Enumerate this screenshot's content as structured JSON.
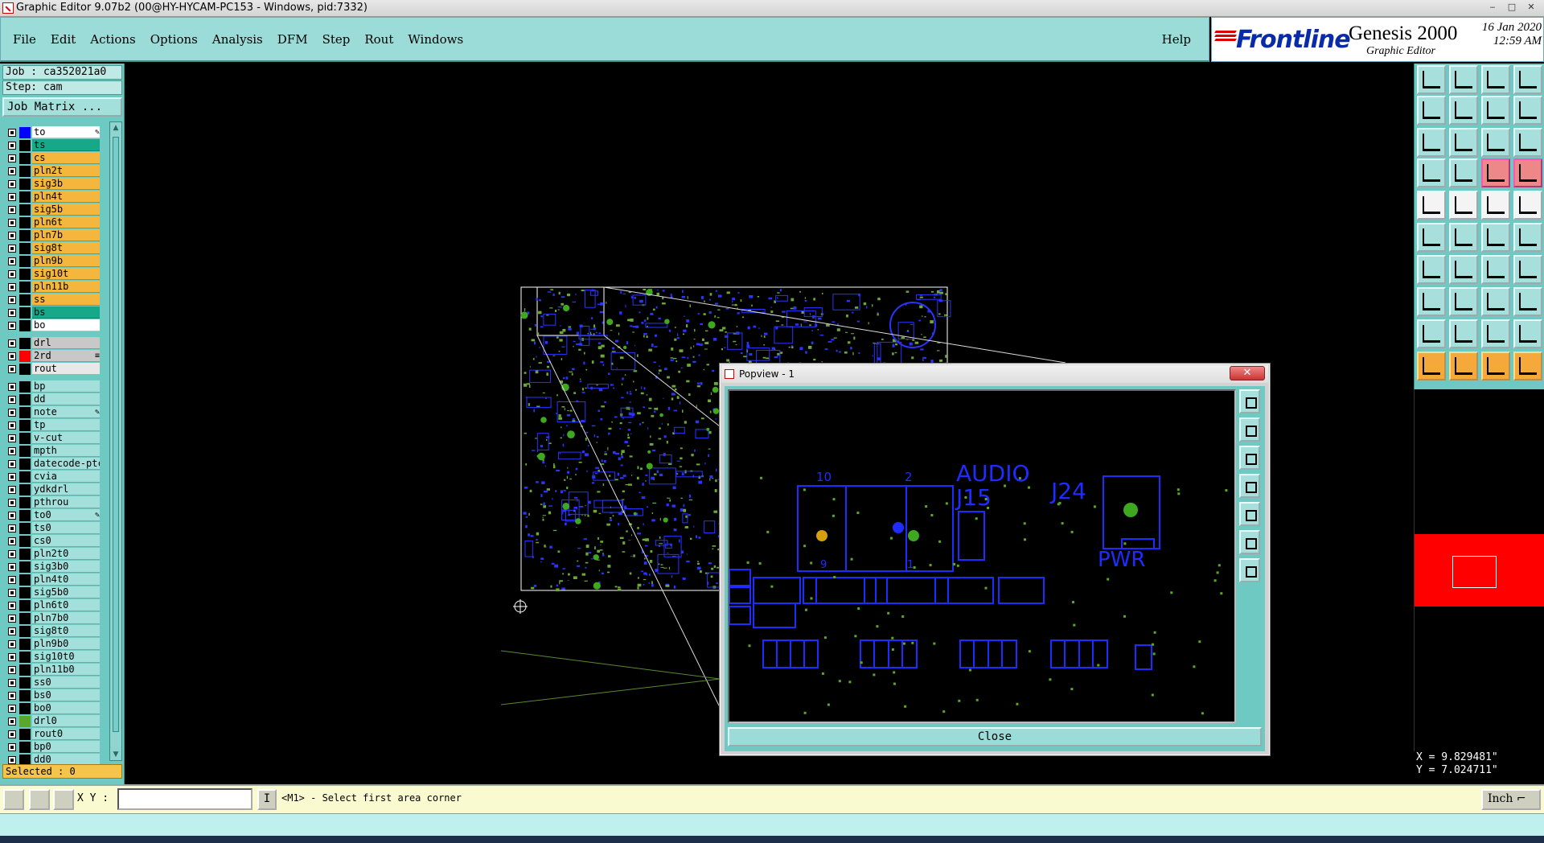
{
  "window": {
    "title": "Graphic Editor 9.07b2 (00@HY-HYCAM-PC153 - Windows, pid:7332)",
    "controls": [
      "‒",
      "□",
      "✕"
    ]
  },
  "menu": {
    "items": [
      "File",
      "Edit",
      "Actions",
      "Options",
      "Analysis",
      "DFM",
      "Step",
      "Rout",
      "Windows"
    ],
    "help": "Help"
  },
  "logo": {
    "brand": "Frontline",
    "product": "Genesis 2000",
    "subtitle": "Graphic Editor",
    "date": "16 Jan 2020",
    "time": "12:59 AM"
  },
  "left": {
    "job": "Job : ca352021a0",
    "step": "Step: cam",
    "job_matrix": "Job Matrix ...",
    "selected": "Selected : 0",
    "layers": [
      {
        "name": "to",
        "color": "#ffffff",
        "swatch": "#0000ff",
        "flag": "✎"
      },
      {
        "name": "ts",
        "color": "#17a88a",
        "swatch": "#000000"
      },
      {
        "name": "cs",
        "color": "#f4b63c",
        "swatch": "#000000"
      },
      {
        "name": "pln2t",
        "color": "#f4b63c",
        "swatch": "#000000"
      },
      {
        "name": "sig3b",
        "color": "#f4b63c",
        "swatch": "#000000"
      },
      {
        "name": "pln4t",
        "color": "#f4b63c",
        "swatch": "#000000"
      },
      {
        "name": "sig5b",
        "color": "#f4b63c",
        "swatch": "#000000"
      },
      {
        "name": "pln6t",
        "color": "#f4b63c",
        "swatch": "#000000"
      },
      {
        "name": "pln7b",
        "color": "#f4b63c",
        "swatch": "#000000"
      },
      {
        "name": "sig8t",
        "color": "#f4b63c",
        "swatch": "#000000"
      },
      {
        "name": "pln9b",
        "color": "#f4b63c",
        "swatch": "#000000"
      },
      {
        "name": "sig10t",
        "color": "#f4b63c",
        "swatch": "#000000"
      },
      {
        "name": "pln11b",
        "color": "#f4b63c",
        "swatch": "#000000"
      },
      {
        "name": "ss",
        "color": "#f4b63c",
        "swatch": "#000000"
      },
      {
        "name": "bs",
        "color": "#17a88a",
        "swatch": "#000000"
      },
      {
        "name": "bo",
        "color": "#ffffff",
        "swatch": "#000000"
      },
      {
        "gap": true
      },
      {
        "name": "drl",
        "color": "#c8c8c8",
        "swatch": "#000000"
      },
      {
        "name": "2rd",
        "color": "#c8c8c8",
        "swatch": "#ff0000",
        "flag": "≡"
      },
      {
        "name": "rout",
        "color": "#e8e8e8",
        "swatch": "#000000"
      },
      {
        "gap": true
      },
      {
        "name": "bp",
        "color": "#a3e0dc",
        "swatch": "#000000"
      },
      {
        "name": "dd",
        "color": "#a3e0dc",
        "swatch": "#000000"
      },
      {
        "name": "note",
        "color": "#a3e0dc",
        "swatch": "#000000",
        "flag": "✎"
      },
      {
        "name": "tp",
        "color": "#a3e0dc",
        "swatch": "#000000"
      },
      {
        "name": "v-cut",
        "color": "#a3e0dc",
        "swatch": "#000000"
      },
      {
        "name": "mpth",
        "color": "#a3e0dc",
        "swatch": "#000000"
      },
      {
        "name": "datecode-ptch",
        "color": "#a3e0dc",
        "swatch": "#000000"
      },
      {
        "name": "cvia",
        "color": "#a3e0dc",
        "swatch": "#000000"
      },
      {
        "name": "ydkdrl",
        "color": "#a3e0dc",
        "swatch": "#000000"
      },
      {
        "name": "pthrou",
        "color": "#a3e0dc",
        "swatch": "#000000"
      },
      {
        "name": "to0",
        "color": "#a3e0dc",
        "swatch": "#000000",
        "flag": "✎"
      },
      {
        "name": "ts0",
        "color": "#a3e0dc",
        "swatch": "#000000"
      },
      {
        "name": "cs0",
        "color": "#a3e0dc",
        "swatch": "#000000"
      },
      {
        "name": "pln2t0",
        "color": "#a3e0dc",
        "swatch": "#000000"
      },
      {
        "name": "sig3b0",
        "color": "#a3e0dc",
        "swatch": "#000000"
      },
      {
        "name": "pln4t0",
        "color": "#a3e0dc",
        "swatch": "#000000"
      },
      {
        "name": "sig5b0",
        "color": "#a3e0dc",
        "swatch": "#000000"
      },
      {
        "name": "pln6t0",
        "color": "#a3e0dc",
        "swatch": "#000000"
      },
      {
        "name": "pln7b0",
        "color": "#a3e0dc",
        "swatch": "#000000"
      },
      {
        "name": "sig8t0",
        "color": "#a3e0dc",
        "swatch": "#000000"
      },
      {
        "name": "pln9b0",
        "color": "#a3e0dc",
        "swatch": "#000000"
      },
      {
        "name": "sig10t0",
        "color": "#a3e0dc",
        "swatch": "#000000"
      },
      {
        "name": "pln11b0",
        "color": "#a3e0dc",
        "swatch": "#000000"
      },
      {
        "name": "ss0",
        "color": "#a3e0dc",
        "swatch": "#000000"
      },
      {
        "name": "bs0",
        "color": "#a3e0dc",
        "swatch": "#000000"
      },
      {
        "name": "bo0",
        "color": "#a3e0dc",
        "swatch": "#000000"
      },
      {
        "name": "drl0",
        "color": "#a3e0dc",
        "swatch": "#5aa82a"
      },
      {
        "name": "rout0",
        "color": "#a3e0dc",
        "swatch": "#000000"
      },
      {
        "name": "bp0",
        "color": "#a3e0dc",
        "swatch": "#000000"
      },
      {
        "name": "dd0",
        "color": "#a3e0dc",
        "swatch": "#000000"
      }
    ]
  },
  "popview": {
    "title": "Popview - 1",
    "close_x": "✕",
    "close_button": "Close",
    "labels": {
      "pin_10": "10",
      "pin_2": "2",
      "pin_9": "9",
      "pin_1": "1",
      "audio": "AUDIO",
      "j15": "J15",
      "j24": "J24",
      "pwr": "PWR"
    }
  },
  "right": {
    "coords": {
      "x": "X = 9.829481\"",
      "y": "Y = 7.024711\""
    }
  },
  "bottom": {
    "xy_label": "X Y :",
    "xy_value": "",
    "mode": "I",
    "prompt": "<M1> - Select first area corner",
    "units": "Inch ⌐"
  },
  "colors": {
    "pcb_trace": "#1e2cff",
    "pcb_pad": "#3ea820",
    "pcb_pad_yellow": "#d4a010",
    "outline": "#ffffff",
    "accent_teal": "#6ec9c2"
  }
}
